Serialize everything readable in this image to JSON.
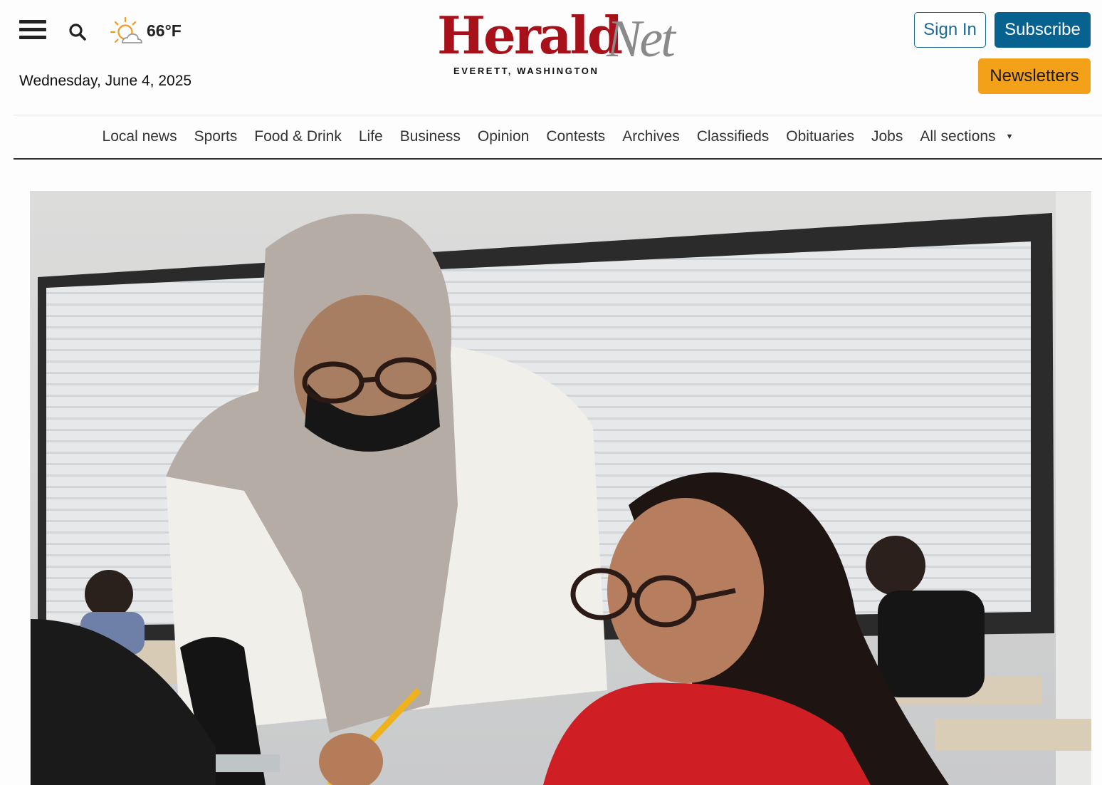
{
  "header": {
    "menu_icon": "hamburger-menu-icon",
    "search_icon": "search-icon",
    "weather": {
      "icon": "partly-sunny-icon",
      "temperature": "66°F"
    },
    "date": "Wednesday, June 4, 2025",
    "logo": {
      "primary": "Herald",
      "secondary": "Net",
      "tagline": "EVERETT, WASHINGTON"
    },
    "sign_in_label": "Sign In",
    "subscribe_label": "Subscribe",
    "newsletters_label": "Newsletters"
  },
  "nav": {
    "items": [
      {
        "label": "Local news"
      },
      {
        "label": "Sports"
      },
      {
        "label": "Food & Drink"
      },
      {
        "label": "Life"
      },
      {
        "label": "Business"
      },
      {
        "label": "Opinion"
      },
      {
        "label": "Contests"
      },
      {
        "label": "Archives"
      },
      {
        "label": "Classifieds"
      },
      {
        "label": "Obituaries"
      },
      {
        "label": "Jobs"
      },
      {
        "label": "All sections"
      }
    ],
    "dropdown_icon": "caret-down-icon"
  },
  "colors": {
    "brand_red": "#a8111a",
    "brand_gray": "#8a8a8a",
    "subscribe_blue": "#07628f",
    "signin_blue": "#1b6b94",
    "newsletters_orange": "#f4a11a"
  },
  "hero_image": {
    "subject": "hero-photo"
  }
}
